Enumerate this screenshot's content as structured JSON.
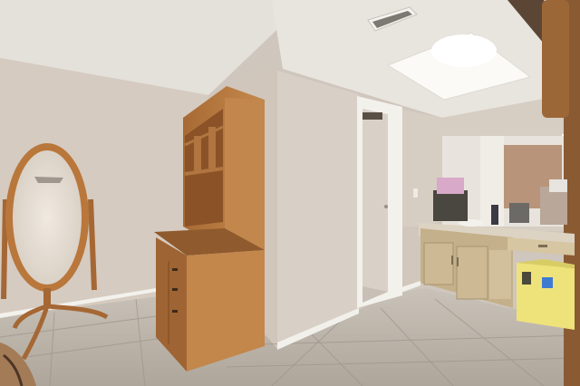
{
  "scene": {
    "kind": "interior-photo",
    "room": "bedroom-with-vanity-area",
    "objects": [
      "oval-floor-mirror",
      "wooden-desk-with-hutch",
      "open-doorway",
      "vanity-cabinet-with-sink",
      "skylight",
      "ceiling-vent",
      "ceiling-fan",
      "yellow-storage-box",
      "tile-floor"
    ],
    "colors": {
      "wall": "#d3c9bf",
      "ceiling": "#e6e2dc",
      "floor_tile": "#b8b0a6",
      "wood": "#b5773d",
      "vanity": "#c9b48f",
      "yellow_box": "#eee27a",
      "skylight": "#fbfaf6"
    }
  }
}
